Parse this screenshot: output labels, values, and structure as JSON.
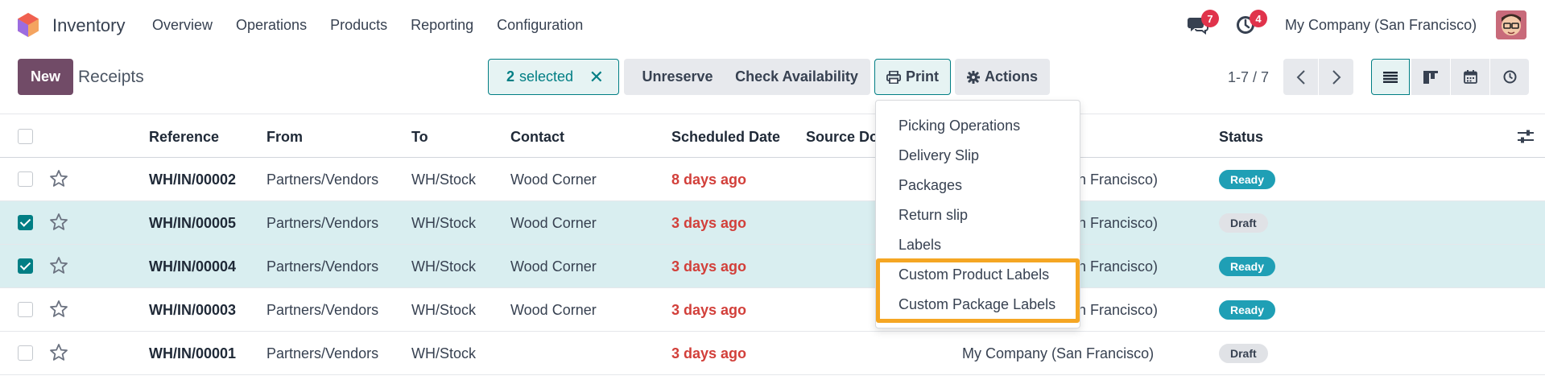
{
  "app": {
    "name": "Inventory",
    "menu": [
      "Overview",
      "Operations",
      "Products",
      "Reporting",
      "Configuration"
    ],
    "company": "My Company (San Francisco)",
    "chat_count": "7",
    "activity_count": "4",
    "logo_colors": [
      "#f06050",
      "#9c6ce0",
      "#f4a460"
    ]
  },
  "control": {
    "new_label": "New",
    "breadcrumb": "Receipts",
    "selected_count": "2",
    "selected_label": "selected",
    "buttons": {
      "unreserve": "Unreserve",
      "check": "Check Availability",
      "print": "Print",
      "actions": "Actions"
    },
    "pager": "1-7 / 7"
  },
  "table": {
    "columns": [
      "Reference",
      "From",
      "To",
      "Contact",
      "Scheduled Date",
      "Source Do",
      "Status"
    ],
    "rows": [
      {
        "ref": "WH/IN/00002",
        "from": "Partners/Vendors",
        "to": "WH/Stock",
        "contact": "Wood Corner",
        "date": "8 days ago",
        "company": "n Francisco)",
        "status": "Ready",
        "selected": false
      },
      {
        "ref": "WH/IN/00005",
        "from": "Partners/Vendors",
        "to": "WH/Stock",
        "contact": "Wood Corner",
        "date": "3 days ago",
        "company": "n Francisco)",
        "status": "Draft",
        "selected": true
      },
      {
        "ref": "WH/IN/00004",
        "from": "Partners/Vendors",
        "to": "WH/Stock",
        "contact": "Wood Corner",
        "date": "3 days ago",
        "company": "n Francisco)",
        "status": "Ready",
        "selected": true
      },
      {
        "ref": "WH/IN/00003",
        "from": "Partners/Vendors",
        "to": "WH/Stock",
        "contact": "Wood Corner",
        "date": "3 days ago",
        "company": "n Francisco)",
        "status": "Ready",
        "selected": false
      },
      {
        "ref": "WH/IN/00001",
        "from": "Partners/Vendors",
        "to": "WH/Stock",
        "contact": "",
        "date": "3 days ago",
        "company": "My Company (San Francisco)",
        "status": "Draft",
        "selected": false
      }
    ]
  },
  "print_menu": {
    "items": [
      "Picking Operations",
      "Delivery Slip",
      "Packages",
      "Return slip",
      "Labels",
      "Custom Product Labels",
      "Custom Package Labels"
    ]
  },
  "colors": {
    "brand": "#714b67",
    "teal": "#017e84",
    "ready": "#1f9fb5",
    "overdue": "#d23f3a",
    "highlight": "#f5a623"
  }
}
